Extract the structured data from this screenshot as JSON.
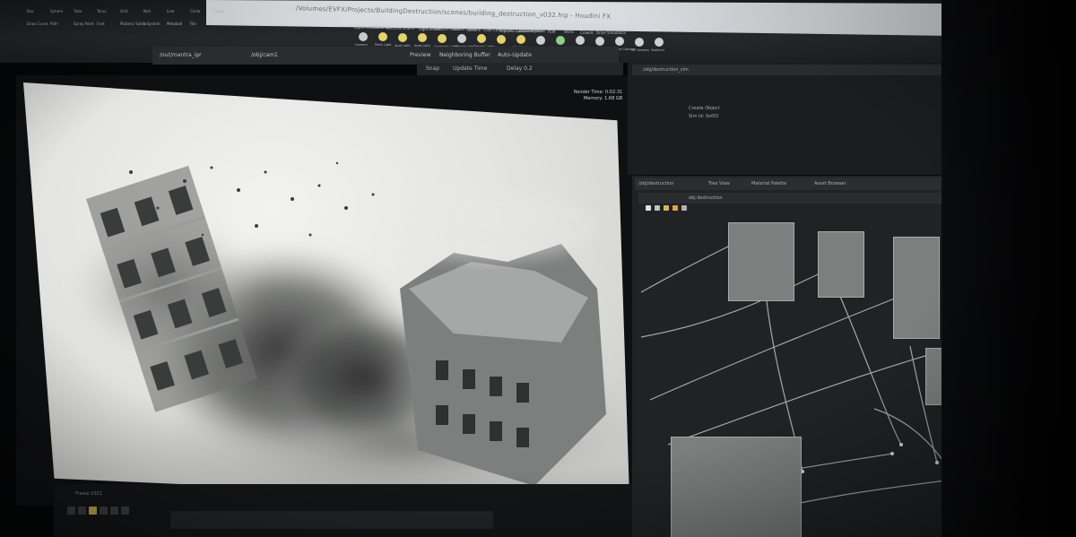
{
  "window": {
    "title": "/Volumes/EVFX/Projects/BuildingDestruction/scenes/building_destruction_v032.hip - Houdini FX"
  },
  "shelf": {
    "tabs": [
      "Lights and Cameras",
      "Collisions",
      "Particles",
      "Grains",
      "Rigid Bodies",
      "Particle Fluids",
      "Viscous Fluids",
      "Oceans",
      "Fluid Containers",
      "Populate Containers",
      "Container Tools",
      "Pyro FX",
      "FEM",
      "Wires",
      "Crowds",
      "Drive Simulation"
    ],
    "tools": [
      "Camera",
      "Point Light",
      "Spot Light",
      "Area Light",
      "Geometry Light",
      "Volume Light",
      "Distant Light",
      "Environment Light",
      "Sky Light",
      "GI Light",
      "Caustic Light",
      "Portal Light",
      "Ambient Light",
      "Stereo Camera",
      "VR Camera",
      "Switcher"
    ],
    "left_tools": [
      "Box",
      "Sphere",
      "Tube",
      "Torus",
      "Grid",
      "Null",
      "Line",
      "Circle",
      "Curve",
      "Draw Curve",
      "Path",
      "Spray Paint",
      "Font",
      "Platonic Solids",
      "L-System",
      "Metaball",
      "File"
    ]
  },
  "viewport_toolbar": {
    "preview_label": "Preview",
    "neighboring_label": "Neighboring Buffer",
    "auto_update_label": "Auto-Update",
    "camera_label": "/obj/cam1",
    "render_label": "/out/mantra_ipr"
  },
  "render_tabs": {
    "items": [
      "Snap",
      "Update Time",
      "Delay 0.2"
    ]
  },
  "render_info": {
    "lines": [
      "Render Time: 0:02:31",
      "Memory: 1.68 GB"
    ]
  },
  "right_top": {
    "header": "/obj/destruction_sim",
    "items": [
      "Create Object",
      "Sim Id: 0x0f2"
    ]
  },
  "network": {
    "tabs": [
      "/obj/destruction",
      "Tree View",
      "Material Palette",
      "Asset Browser"
    ],
    "path": "obj  destruction"
  },
  "timeline": {
    "label": "Frame 1021"
  }
}
